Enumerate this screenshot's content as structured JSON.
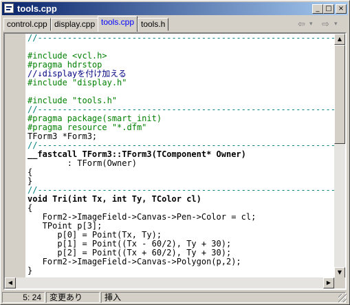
{
  "window": {
    "title": "tools.cpp"
  },
  "caption_buttons": {
    "minimize": "_",
    "maximize": "□",
    "close": "×"
  },
  "tabs": [
    {
      "label": "control.cpp"
    },
    {
      "label": "display.cpp"
    },
    {
      "label": "tools.cpp",
      "active": true
    },
    {
      "label": "tools.h"
    }
  ],
  "nav": {
    "back": "⇦",
    "back_drop": "▾",
    "forward": "⇨",
    "forward_drop": "▾"
  },
  "code_lines": [
    "//---------------------------------------------------------------------------",
    "",
    "#include <vcl.h>",
    "#pragma hdrstop",
    "//↓displayを付け加える",
    "#include \"display.h\"",
    "",
    "#include \"tools.h\"",
    "//---------------------------------------------------------------------------",
    "#pragma package(smart_init)",
    "#pragma resource \"*.dfm\"",
    "TForm3 *Form3;",
    "//---------------------------------------------------------------------------",
    "__fastcall TForm3::TForm3(TComponent* Owner)",
    "        : TForm(Owner)",
    "{",
    "}",
    "//---------------------------------------------------------------------------",
    "void Tri(int Tx, int Ty, TColor cl)",
    "{",
    "   Form2->ImageField->Canvas->Pen->Color = cl;",
    "   TPoint p[3];",
    "      p[0] = Point(Tx, Ty);",
    "      p[1] = Point((Tx - 60/2), Ty + 30);",
    "      p[2] = Point((Tx + 60/2), Ty + 30);",
    "   Form2->ImageField->Canvas->Polygon(p,2);",
    "}"
  ],
  "scrollbars": {
    "up": "▲",
    "down": "▼",
    "left": "◀",
    "right": "▶"
  },
  "status": {
    "position": "5: 24",
    "modified": "変更あり",
    "mode": "挿入"
  }
}
